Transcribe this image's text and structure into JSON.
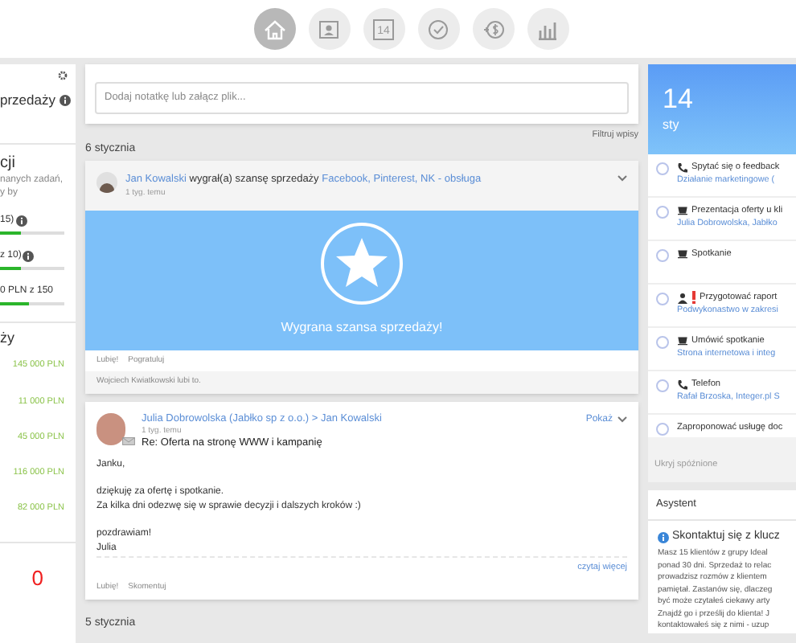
{
  "nav": [
    {
      "selected": true
    },
    {
      "selected": false
    },
    {
      "label": "14",
      "selected": false
    },
    {
      "selected": false
    },
    {
      "selected": false
    },
    {
      "selected": false
    }
  ],
  "left_panel": {
    "title": "przedaży",
    "section_title": "cji",
    "description": [
      "nanych zadań,",
      "y by"
    ],
    "metrics": [
      {
        "label": "15)",
        "level": 0.33
      },
      {
        "label": "z 10)",
        "level": 0.33
      },
      {
        "label": "0 PLN z 150",
        "level": 0.45
      }
    ],
    "amounts_title": "ży",
    "amounts": [
      "145 000 PLN",
      "11 000 PLN",
      "45 000 PLN",
      "116 000 PLN",
      "82 000 PLN"
    ],
    "counter": "0"
  },
  "feed": {
    "note_placeholder": "Dodaj notatkę lub załącz plik...",
    "filter": "Filtruj wpisy",
    "days": [
      {
        "date": "6 stycznia"
      },
      {
        "date": "5 stycznia"
      }
    ],
    "win_post": {
      "author": "Jan Kowalski",
      "action": "wygrał(a) szansę sprzedaży",
      "target": "Facebook, Pinterest, NK - obsługa",
      "time": "1 tyg. temu",
      "banner": "Wygrana szansa sprzedaży!",
      "actions": [
        "Lubię!",
        "Pogratuluj"
      ],
      "likes": "Wojciech Kwiatkowski lubi to."
    },
    "mail_post": {
      "from": "Julia Dobrowolska (Jabłko sp z o.o.)",
      "separator": ">",
      "to": "Jan Kowalski",
      "time": "1 tyg. temu",
      "subject": "Re: Oferta na stronę WWW i kampanię",
      "show": "Pokaż",
      "paragraphs": [
        [
          "Janku,"
        ],
        [
          "dziękuję za ofertę i spotkanie.",
          "Za kilka dni odezwę się w sprawie decyzji i dalszych kroków :)"
        ],
        [
          "pozdrawiam!",
          "Julia"
        ]
      ],
      "read_more": "czytaj więcej",
      "actions": [
        "Lubię!",
        "Skomentuj"
      ]
    }
  },
  "calendar": {
    "day": "14",
    "month": "sty",
    "tasks": [
      {
        "kind": "call",
        "priority": false,
        "checked": false,
        "title": "Spytać się o feedback",
        "subtitle": "Działanie marketingowe ("
      },
      {
        "kind": "meeting",
        "priority": false,
        "checked": false,
        "title": "Prezentacja oferty u kli",
        "subtitle": "Julia Dobrowolska, Jabłko"
      },
      {
        "kind": "meeting",
        "priority": false,
        "checked": false,
        "title": "Spotkanie"
      },
      {
        "kind": "task",
        "priority": true,
        "checked": false,
        "title": "Przygotować raport",
        "subtitle": "Podwykonastwo w zakresi"
      },
      {
        "kind": "meeting",
        "priority": false,
        "checked": false,
        "title": "Umówić spotkanie",
        "subtitle": "Strona internetowa i integ"
      },
      {
        "kind": "call",
        "priority": false,
        "checked": false,
        "title": "Telefon",
        "subtitle": "Rafał Brzoska, Integer.pl S"
      },
      {
        "kind": "plain",
        "priority": false,
        "checked": false,
        "title": "Zaproponować usługę doc"
      }
    ],
    "hide_overdue": "Ukryj spóźnione"
  },
  "assistant": {
    "title": "Asystent",
    "heading": "Skontaktuj się z klucz",
    "lines": [
      "Masz 15 klientów z grupy Ideal",
      "ponad 30 dni. Sprzedaż to relac",
      "prowadzisz rozmów z klientem",
      "pamiętał. Zastanów się, dlaczeg",
      "być może czytałeś ciekawy arty",
      "Znajdź go i prześlij do klienta! J",
      "kontaktowałeś się z nimi - uzup"
    ]
  }
}
